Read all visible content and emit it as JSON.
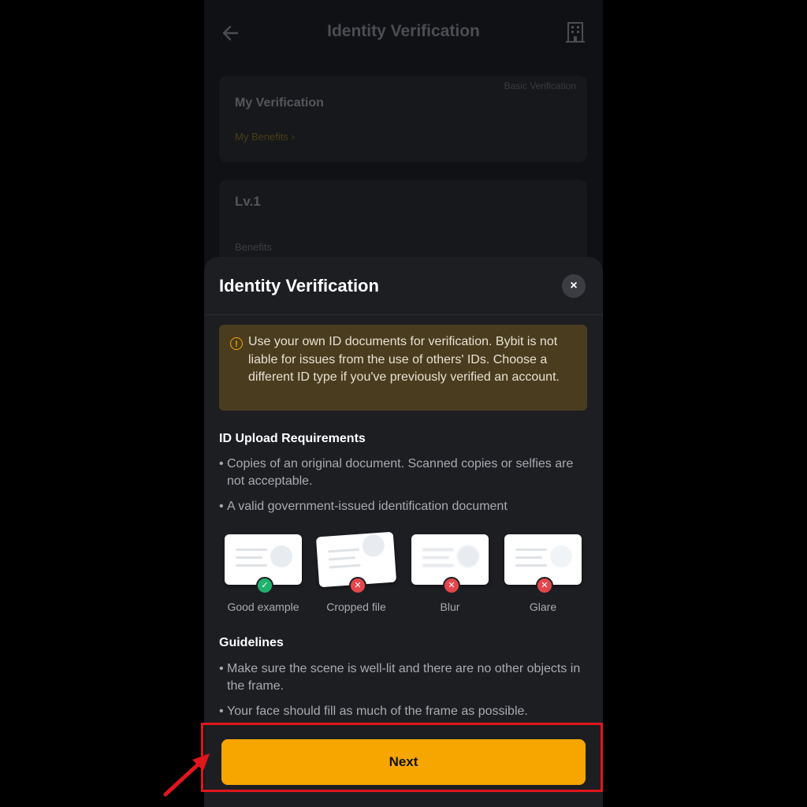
{
  "background": {
    "header_title": "Identity Verification",
    "card1": {
      "badge": "Basic Verification",
      "title": "My Verification",
      "link": "My Benefits"
    },
    "card2": {
      "level": "Lv.1",
      "benefits": "Benefits"
    }
  },
  "sheet": {
    "title": "Identity Verification",
    "close_icon": "×",
    "warning_text": "Use your own ID documents for verification. Bybit is not liable for issues from the use of others' IDs. Choose a different ID type if you've previously verified an account.",
    "requirements_title": "ID Upload Requirements",
    "requirements": [
      "Copies of an original document. Scanned copies or selfies are not acceptable.",
      "A valid government-issued identification document"
    ],
    "examples": [
      {
        "label": "Good example",
        "status": "ok"
      },
      {
        "label": "Cropped file",
        "status": "bad"
      },
      {
        "label": "Blur",
        "status": "bad"
      },
      {
        "label": "Glare",
        "status": "bad"
      }
    ],
    "guidelines_title": "Guidelines",
    "guidelines": [
      "Make sure the scene is well-lit and there are no other objects in the frame.",
      "Your face should fill as much of the frame as possible."
    ],
    "next_label": "Next"
  },
  "colors": {
    "accent": "#f7a600",
    "highlight": "#e0161d",
    "ok": "#20b26c",
    "bad": "#e2474c"
  }
}
